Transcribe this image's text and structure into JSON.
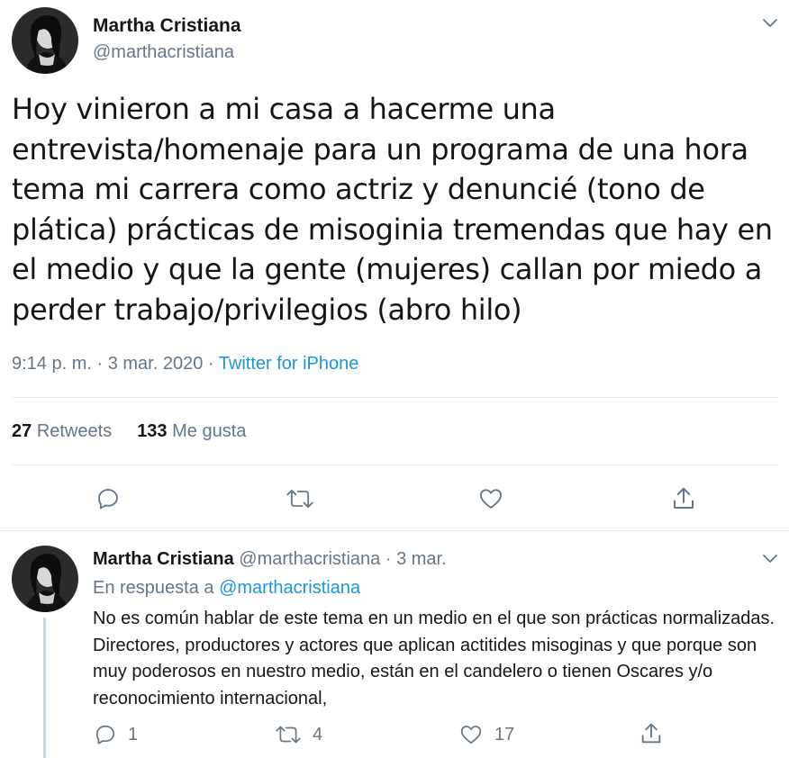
{
  "main_tweet": {
    "author_name": "Martha Cristiana",
    "handle": "@marthacristiana",
    "text": "Hoy vinieron a mi casa a hacerme una entrevista/homenaje para un programa de una hora tema mi carrera como actriz y denuncié (tono de plática) prácticas de misoginia tremendas que hay en el medio y que la gente (mujeres) callan por miedo a perder trabajo/privilegios (abro hilo)",
    "timestamp": "9:14 p. m. · 3 mar. 2020",
    "separator": " · ",
    "source": "Twitter for iPhone",
    "retweets_count": "27",
    "retweets_label": "Retweets",
    "likes_count": "133",
    "likes_label": "Me gusta",
    "icons": [
      "reply-icon",
      "retweet-icon",
      "like-icon",
      "share-icon"
    ]
  },
  "reply_tweet": {
    "author_name": "Martha Cristiana",
    "handle": "@marthacristiana",
    "separator": " · ",
    "date": "3 mar.",
    "in_reply_to_label": "En respuesta a",
    "in_reply_to_handle": "@marthacristiana",
    "text": "No es común hablar de este tema en un medio en el que son prácticas normalizadas. Directores, productores y actores que aplican actitides misoginas y que porque son muy poderosos en nuestro medio, están en el candelero o tienen Oscares y/o reconocimiento internacional,",
    "reply_count": "1",
    "retweet_count": "4",
    "like_count": "17"
  },
  "colors": {
    "text": "#14171a",
    "secondary": "#657786",
    "link": "#1b95e0",
    "divider": "#e6ecf0",
    "thread_line": "#ccd6dd"
  }
}
